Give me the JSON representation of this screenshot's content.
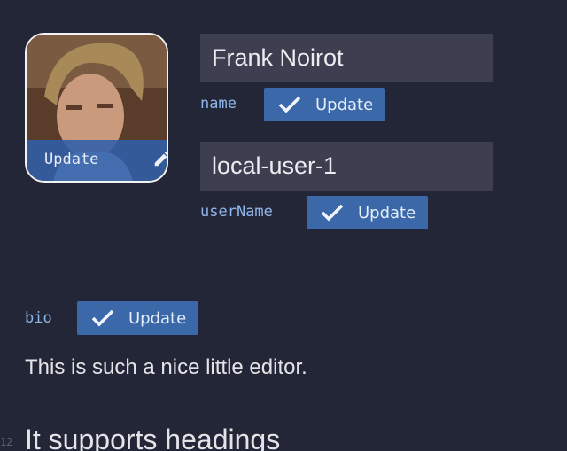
{
  "avatar": {
    "update_label": "Update",
    "edit_icon": "pencil-icon"
  },
  "name": {
    "label": "name",
    "value": "Frank Noirot",
    "button_label": "Update"
  },
  "userName": {
    "label": "userName",
    "value": "local-user-1",
    "button_label": "Update"
  },
  "bio": {
    "label": "bio",
    "button_label": "Update"
  },
  "editor": {
    "paragraph": "This is such a nice little editor.",
    "line_number": "12",
    "heading": "It supports headings"
  },
  "colors": {
    "background": "#232637",
    "accent": "#3a68a9",
    "label": "#8fb6ea",
    "field": "#3d3f51"
  }
}
